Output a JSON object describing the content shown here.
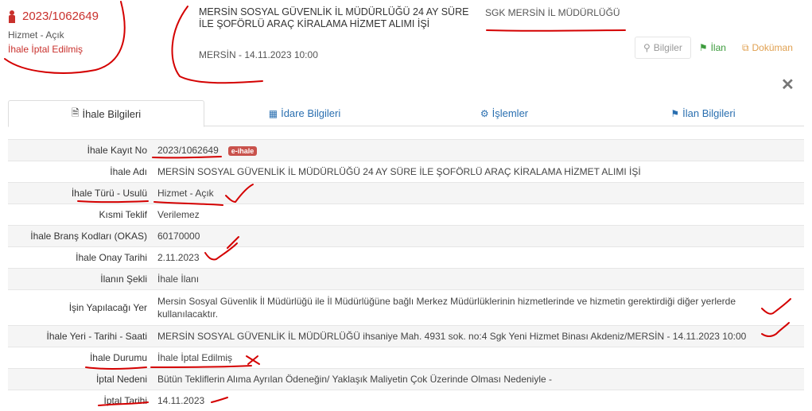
{
  "header": {
    "kayit_no": "2023/1062649",
    "tur": "Hizmet - Açık",
    "durum": "İhale İptal Edilmiş",
    "ihale_adi": "MERSİN SOSYAL GÜVENLİK İL MÜDÜRLÜĞÜ 24 AY SÜRE İLE ŞOFÖRLÜ ARAÇ KİRALAMA HİZMET ALIMI İŞİ",
    "yer_tarih": "MERSİN - 14.11.2023 10:00",
    "idare": "SGK MERSİN İL MÜDÜRLÜĞÜ"
  },
  "actions": {
    "bilgiler": "Bilgiler",
    "ilan": "İlan",
    "dokuman": "Doküman"
  },
  "tabs": [
    {
      "label": "İhale Bilgileri",
      "icon": "file-icon"
    },
    {
      "label": "İdare Bilgileri",
      "icon": "building-icon"
    },
    {
      "label": "İşlemler",
      "icon": "gears-icon"
    },
    {
      "label": "İlan Bilgileri",
      "icon": "megaphone-icon"
    }
  ],
  "badge": "e-ihale",
  "rows": [
    {
      "label": "İhale Kayıt No",
      "value": "2023/1062649"
    },
    {
      "label": "İhale Adı",
      "value": "MERSİN SOSYAL GÜVENLİK İL MÜDÜRLÜĞÜ 24 AY SÜRE İLE ŞOFÖRLÜ ARAÇ KİRALAMA HİZMET ALIMI İŞİ"
    },
    {
      "label": "İhale Türü - Usulü",
      "value": "Hizmet - Açık"
    },
    {
      "label": "Kısmi Teklif",
      "value": "Verilemez"
    },
    {
      "label": "İhale Branş Kodları (OKAS)",
      "value": "60170000"
    },
    {
      "label": "İhale Onay Tarihi",
      "value": "2.11.2023"
    },
    {
      "label": "İlanın Şekli",
      "value": "İhale İlanı"
    },
    {
      "label": "İşin Yapılacağı Yer",
      "value": "Mersin Sosyal Güvenlik İl Müdürlüğü ile İl Müdürlüğüne bağlı Merkez Müdürlüklerinin hizmetlerinde ve hizmetin gerektirdiği diğer yerlerde kullanılacaktır."
    },
    {
      "label": "İhale Yeri - Tarihi - Saati",
      "value": "MERSİN SOSYAL GÜVENLİK İL MÜDÜRLÜĞÜ ihsaniye Mah. 4931 sok. no:4 Sgk Yeni Hizmet Binası Akdeniz/MERSİN - 14.11.2023 10:00"
    },
    {
      "label": "İhale Durumu",
      "value": "İhale İptal Edilmiş"
    },
    {
      "label": "İptal Nedeni",
      "value": "Bütün Tekliflerin Alıma Ayrılan Ödeneğin/ Yaklaşık Maliyetin Çok Üzerinde Olması Nedeniyle -"
    },
    {
      "label": "İptal Tarihi",
      "value": "14.11.2023"
    }
  ],
  "colors": {
    "accent_red": "#c9302c",
    "link_blue": "#2a6fb0",
    "ilan_green": "#3c9b3c",
    "dokuman_orange": "#e0a050",
    "annotation_red": "#d40000"
  }
}
